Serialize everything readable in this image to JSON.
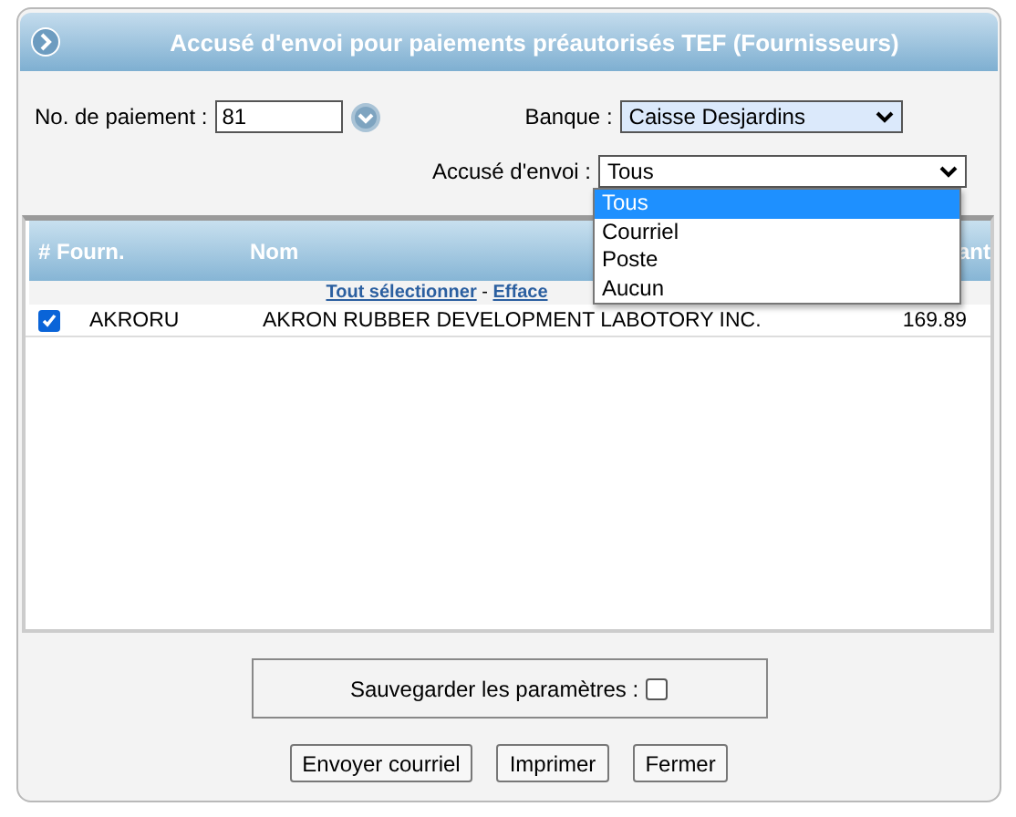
{
  "window": {
    "title": "Accusé d'envoi pour paiements préautorisés TEF (Fournisseurs)"
  },
  "form": {
    "payment_label": "No. de paiement :",
    "payment_value": "81",
    "bank_label": "Banque :",
    "bank_value": "Caisse Desjardins",
    "ack_label": "Accusé d'envoi :",
    "ack_value": "Tous",
    "ack_options": [
      {
        "label": "Tous",
        "selected": true
      },
      {
        "label": "Courriel",
        "selected": false
      },
      {
        "label": "Poste",
        "selected": false
      },
      {
        "label": "Aucun",
        "selected": false
      }
    ]
  },
  "table": {
    "columns": [
      "# Fourn.",
      "Nom",
      "ant"
    ],
    "select_all": "Tout sélectionner",
    "separator": "-",
    "clear_all": "Efface",
    "rows": [
      {
        "checked": true,
        "supplier": "AKRORU",
        "name": "AKRON RUBBER DEVELOPMENT LABOTORY INC.",
        "amount": "169.89"
      }
    ]
  },
  "save": {
    "label": "Sauvegarder les paramètres :",
    "checked": false
  },
  "buttons": [
    "Envoyer courriel",
    "Imprimer",
    "Fermer"
  ]
}
